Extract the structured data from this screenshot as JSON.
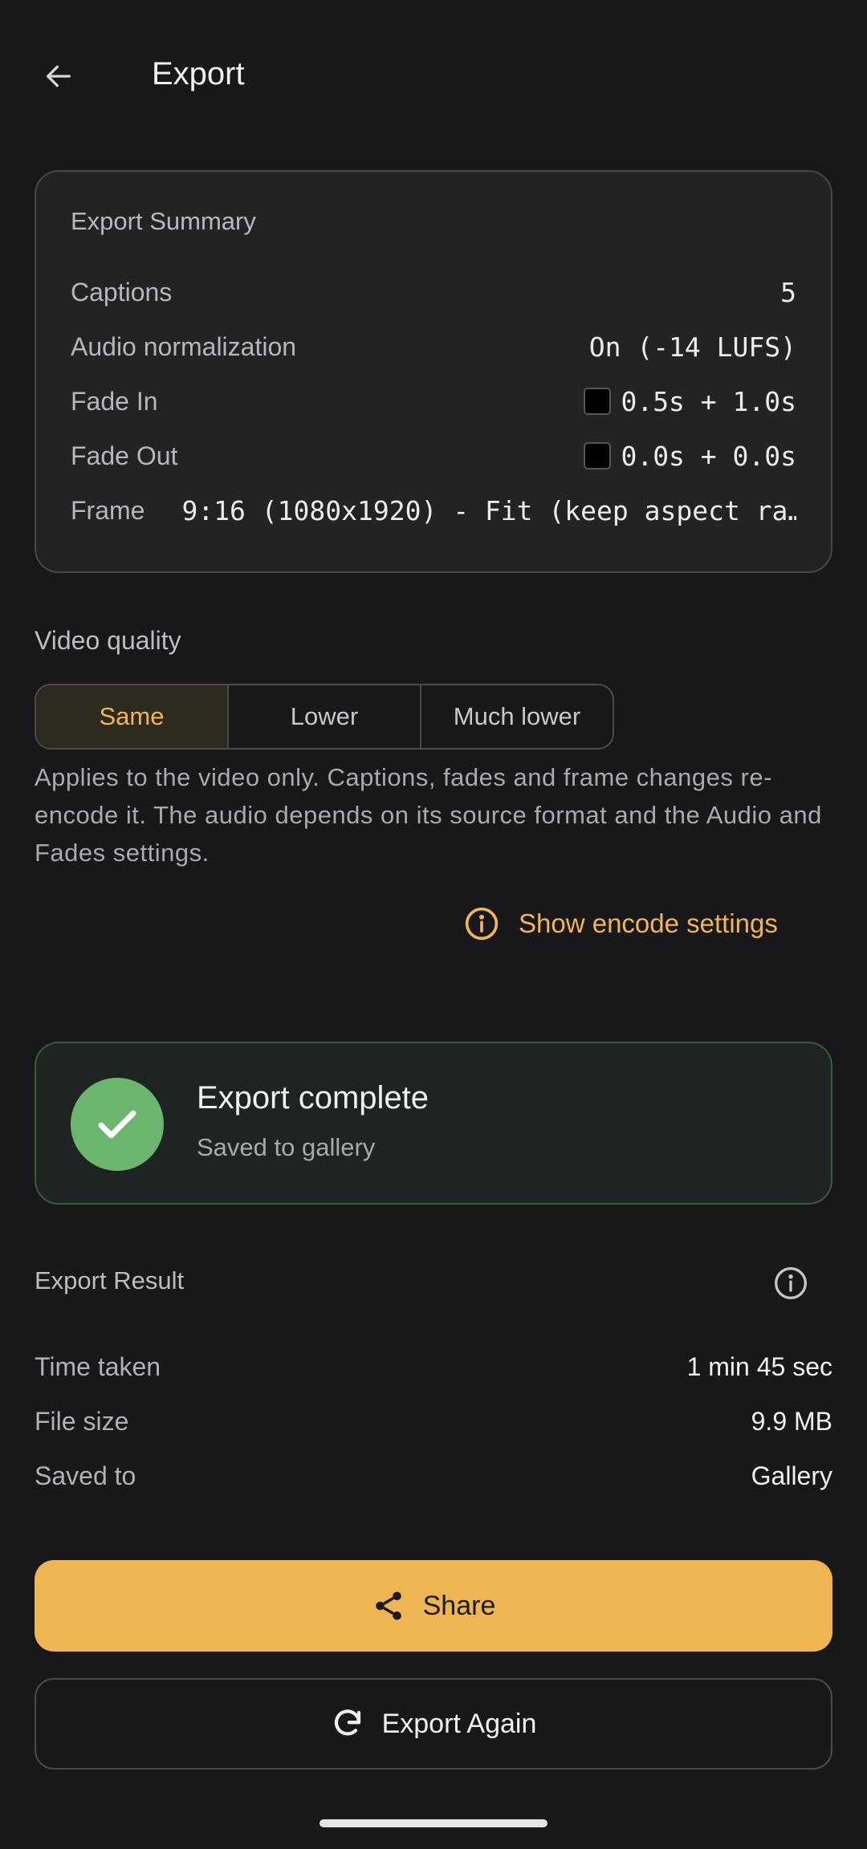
{
  "header": {
    "title": "Export",
    "back_icon": "arrow-left-icon"
  },
  "summary": {
    "title": "Export Summary",
    "rows": [
      {
        "label": "Captions",
        "value": "5"
      },
      {
        "label": "Audio normalization",
        "value": "On (-14 LUFS)"
      },
      {
        "label": "Fade In",
        "value": "0.5s + 1.0s",
        "swatch": "#000000"
      },
      {
        "label": "Fade Out",
        "value": "0.0s + 0.0s",
        "swatch": "#000000"
      },
      {
        "label": "Frame",
        "value": "9:16 (1080x1920) - Fit (keep aspect ra…"
      }
    ]
  },
  "video_quality": {
    "label": "Video quality",
    "options": [
      "Same",
      "Lower",
      "Much lower"
    ],
    "selected": "Same",
    "help": "Applies to the video only. Captions, fades and frame changes re-encode it. The audio depends on its source format and the Audio and Fades settings.",
    "encode_link": "Show encode settings"
  },
  "status": {
    "title": "Export complete",
    "subtitle": "Saved to gallery",
    "icon": "checkmark-icon"
  },
  "result": {
    "label": "Export Result",
    "rows": [
      {
        "label": "Time taken",
        "value": "1 min 45 sec"
      },
      {
        "label": "File size",
        "value": "9.9 MB"
      },
      {
        "label": "Saved to",
        "value": "Gallery"
      }
    ]
  },
  "actions": {
    "share": "Share",
    "export_again": "Export Again"
  },
  "colors": {
    "background": "#18181b",
    "accent": "#efb552",
    "success": "#6bb56e"
  }
}
